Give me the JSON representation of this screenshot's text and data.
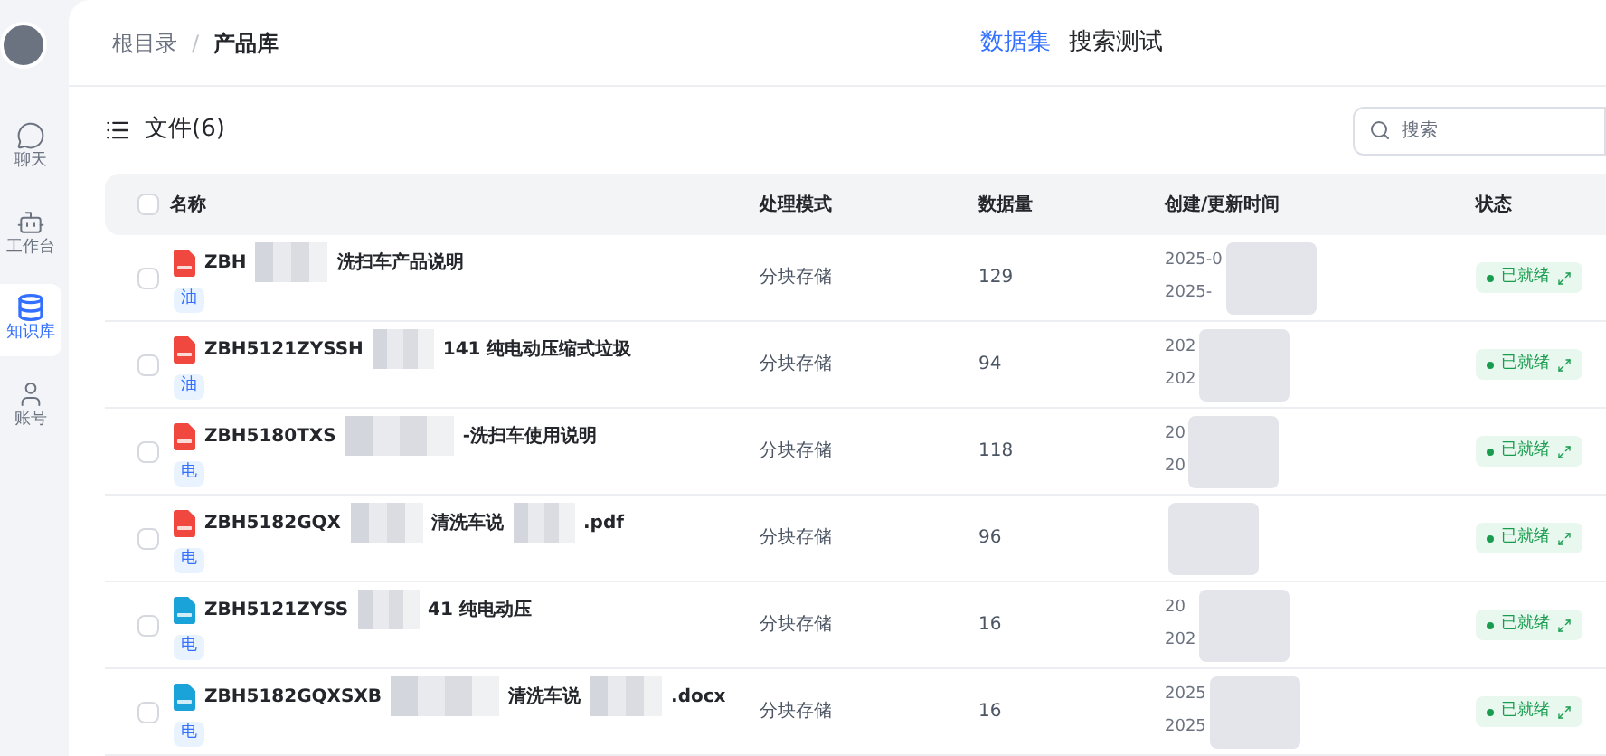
{
  "sidebar": {
    "items": [
      {
        "label": "聊天",
        "kind": "chat",
        "selected": false
      },
      {
        "label": "工作台",
        "kind": "robot",
        "selected": false
      },
      {
        "label": "知识库",
        "kind": "database",
        "selected": true
      },
      {
        "label": "账号",
        "kind": "user",
        "selected": false
      }
    ]
  },
  "breadcrumb": [
    "根目录",
    "产品库"
  ],
  "breadcrumb_separator": "/",
  "tabs": [
    {
      "label": "数据集",
      "selected": true
    },
    {
      "label": "搜索测试",
      "selected": false
    }
  ],
  "files_title": "文件(6)",
  "search": {
    "placeholder": "搜索"
  },
  "table": {
    "columns": [
      "名称",
      "处理模式",
      "数据量",
      "创建/更新时间",
      "状态"
    ],
    "select_all_checked": false,
    "rows": [
      {
        "checked": false,
        "name_parts": [
          "ZBH",
          "洗扫车产品说明"
        ],
        "kind": "pdf",
        "tag": "油",
        "mode": "分块存储",
        "count": "129",
        "dates": [
          "2025-0",
          "2025-"
        ],
        "status": "已就绪"
      },
      {
        "checked": false,
        "name_parts": [
          "ZBH5121ZYSSH",
          "141 纯电动压缩式垃圾"
        ],
        "kind": "pdf",
        "tag": "油",
        "mode": "分块存储",
        "count": "94",
        "dates": [
          "202",
          "202"
        ],
        "status": "已就绪"
      },
      {
        "checked": false,
        "name_parts": [
          "ZBH5180TXS",
          "-洗扫车使用说明"
        ],
        "kind": "pdf",
        "tag": "电",
        "mode": "分块存储",
        "count": "118",
        "dates": [
          "20",
          "20"
        ],
        "status": "已就绪"
      },
      {
        "checked": false,
        "name_parts": [
          "ZBH5182GQX",
          "清洗车说",
          ".pdf"
        ],
        "kind": "pdf",
        "tag": "电",
        "mode": "分块存储",
        "count": "96",
        "dates": [],
        "status": "已就绪"
      },
      {
        "checked": false,
        "name_parts": [
          "ZBH5121ZYSS",
          "41 纯电动压"
        ],
        "kind": "doc",
        "tag": "电",
        "mode": "分块存储",
        "count": "16",
        "dates": [
          "20",
          "202"
        ],
        "status": "已就绪"
      },
      {
        "checked": false,
        "name_parts": [
          "ZBH5182GQXSXB",
          "清洗车说",
          ".docx"
        ],
        "kind": "doc",
        "tag": "电",
        "mode": "分块存储",
        "count": "16",
        "dates": [
          "2025",
          "2025"
        ],
        "status": "已就绪"
      }
    ]
  }
}
